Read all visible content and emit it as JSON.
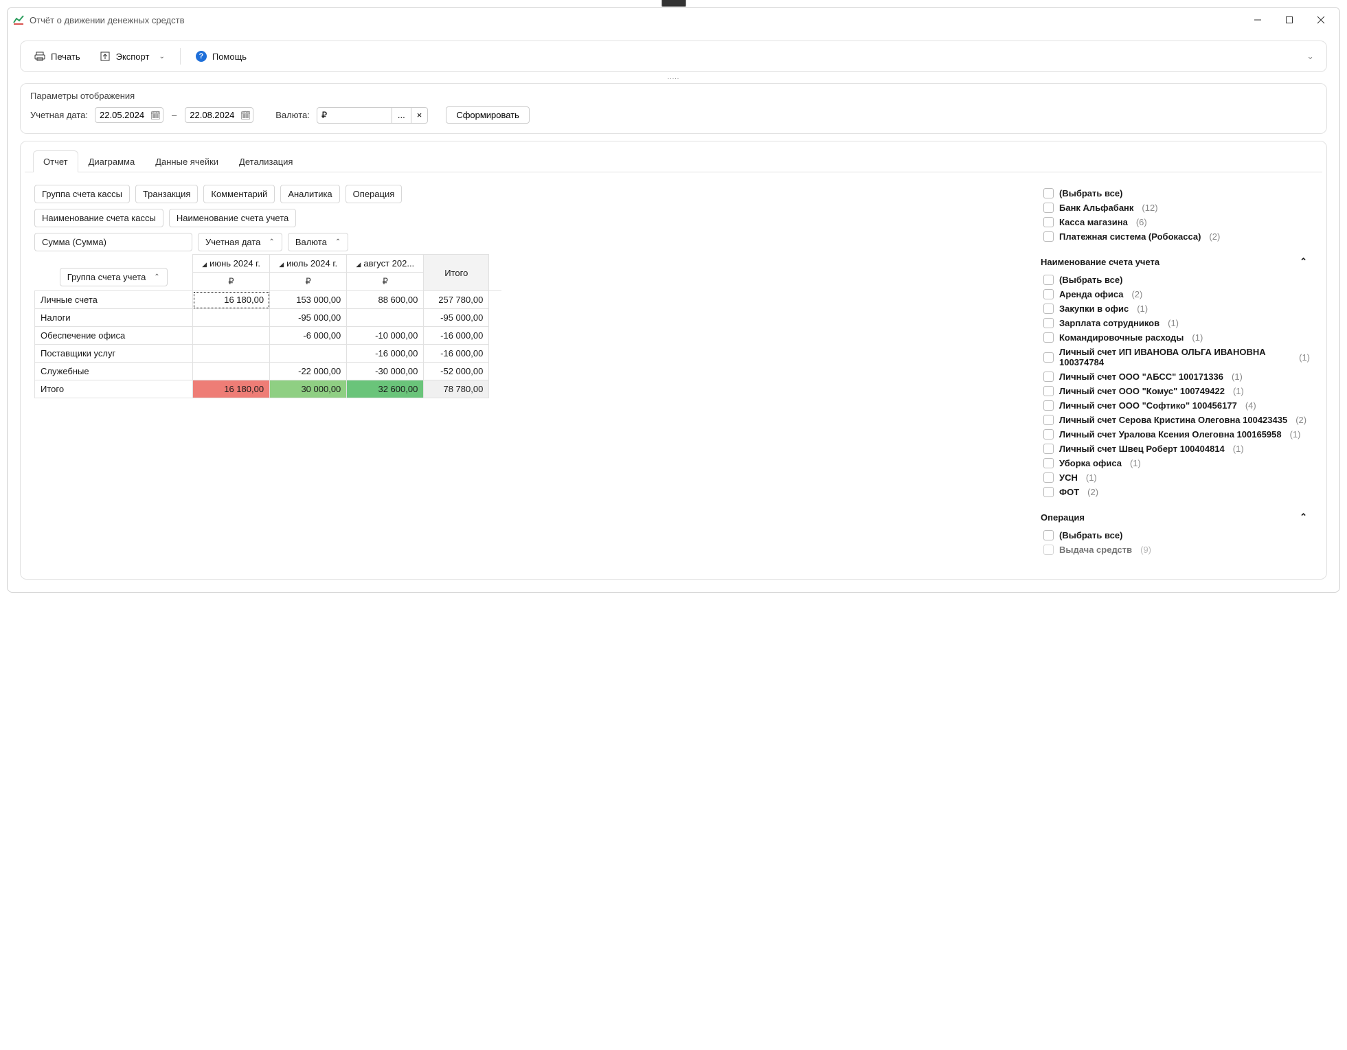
{
  "window": {
    "title": "Отчёт о движении денежных средств"
  },
  "toolbar": {
    "print": "Печать",
    "export": "Экспорт",
    "help": "Помощь"
  },
  "params": {
    "title": "Параметры отображения",
    "date_label": "Учетная дата:",
    "date_from": "22.05.2024",
    "date_to": "22.08.2024",
    "currency_label": "Валюта:",
    "currency_value": "₽",
    "ellipsis": "...",
    "clear": "×",
    "submit": "Сформировать"
  },
  "tabs": {
    "report": "Отчет",
    "chart": "Диаграмма",
    "cell_data": "Данные ячейки",
    "detail": "Детализация"
  },
  "pivot": {
    "field_chips": [
      "Группа счета кассы",
      "Транзакция",
      "Комментарий",
      "Аналитика",
      "Операция",
      "Наименование счета кассы",
      "Наименование счета учета"
    ],
    "measure_chip": "Сумма (Сумма)",
    "col_dims": [
      "Учетная дата",
      "Валюта"
    ],
    "row_dim": "Группа счета учета",
    "col_headers": [
      "июнь 2024 г.",
      "июль 2024 г.",
      "август 202..."
    ],
    "col_sub": "₽",
    "total_label": "Итого",
    "rows": [
      {
        "label": "Личные счета",
        "v": [
          "16 180,00",
          "153 000,00",
          "88 600,00",
          "257 780,00"
        ]
      },
      {
        "label": "Налоги",
        "v": [
          "",
          "-95 000,00",
          "",
          "-95 000,00"
        ]
      },
      {
        "label": "Обеспечение офиса",
        "v": [
          "",
          "-6 000,00",
          "-10 000,00",
          "-16 000,00"
        ]
      },
      {
        "label": "Поставщики услуг",
        "v": [
          "",
          "",
          "-16 000,00",
          "-16 000,00"
        ]
      },
      {
        "label": "Служебные",
        "v": [
          "",
          "-22 000,00",
          "-30 000,00",
          "-52 000,00"
        ]
      }
    ],
    "grand_total": {
      "label": "Итого",
      "v": [
        "16 180,00",
        "30 000,00",
        "32 600,00",
        "78 780,00"
      ]
    }
  },
  "filters": {
    "select_all": "(Выбрать все)",
    "group1": {
      "items": [
        {
          "label": "Банк Альфабанк",
          "count": "(12)"
        },
        {
          "label": "Касса магазина",
          "count": "(6)"
        },
        {
          "label": "Платежная система (Робокасса)",
          "count": "(2)"
        }
      ]
    },
    "group2": {
      "title": "Наименование счета учета",
      "items": [
        {
          "label": "Аренда офиса",
          "count": "(2)"
        },
        {
          "label": "Закупки в офис",
          "count": "(1)"
        },
        {
          "label": "Зарплата сотрудников",
          "count": "(1)"
        },
        {
          "label": "Командировочные расходы",
          "count": "(1)"
        },
        {
          "label": "Личный счет ИП ИВАНОВА ОЛЬГА ИВАНОВНА 100374784",
          "count": "(1)"
        },
        {
          "label": "Личный счет ООО \"АБСС\" 100171336",
          "count": "(1)"
        },
        {
          "label": "Личный счет ООО \"Комус\" 100749422",
          "count": "(1)"
        },
        {
          "label": "Личный счет ООО \"Софтико\" 100456177",
          "count": "(4)"
        },
        {
          "label": "Личный счет Серова Кристина Олеговна 100423435",
          "count": "(2)"
        },
        {
          "label": "Личный счет Уралова Ксения Олеговна 100165958",
          "count": "(1)"
        },
        {
          "label": "Личный счет Швец Роберт 100404814",
          "count": "(1)"
        },
        {
          "label": "Уборка офиса",
          "count": "(1)"
        },
        {
          "label": "УСН",
          "count": "(1)"
        },
        {
          "label": "ФОТ",
          "count": "(2)"
        }
      ]
    },
    "group3": {
      "title": "Операция",
      "items": [
        {
          "label": "Выдача средств",
          "count": "(9)"
        }
      ]
    }
  }
}
